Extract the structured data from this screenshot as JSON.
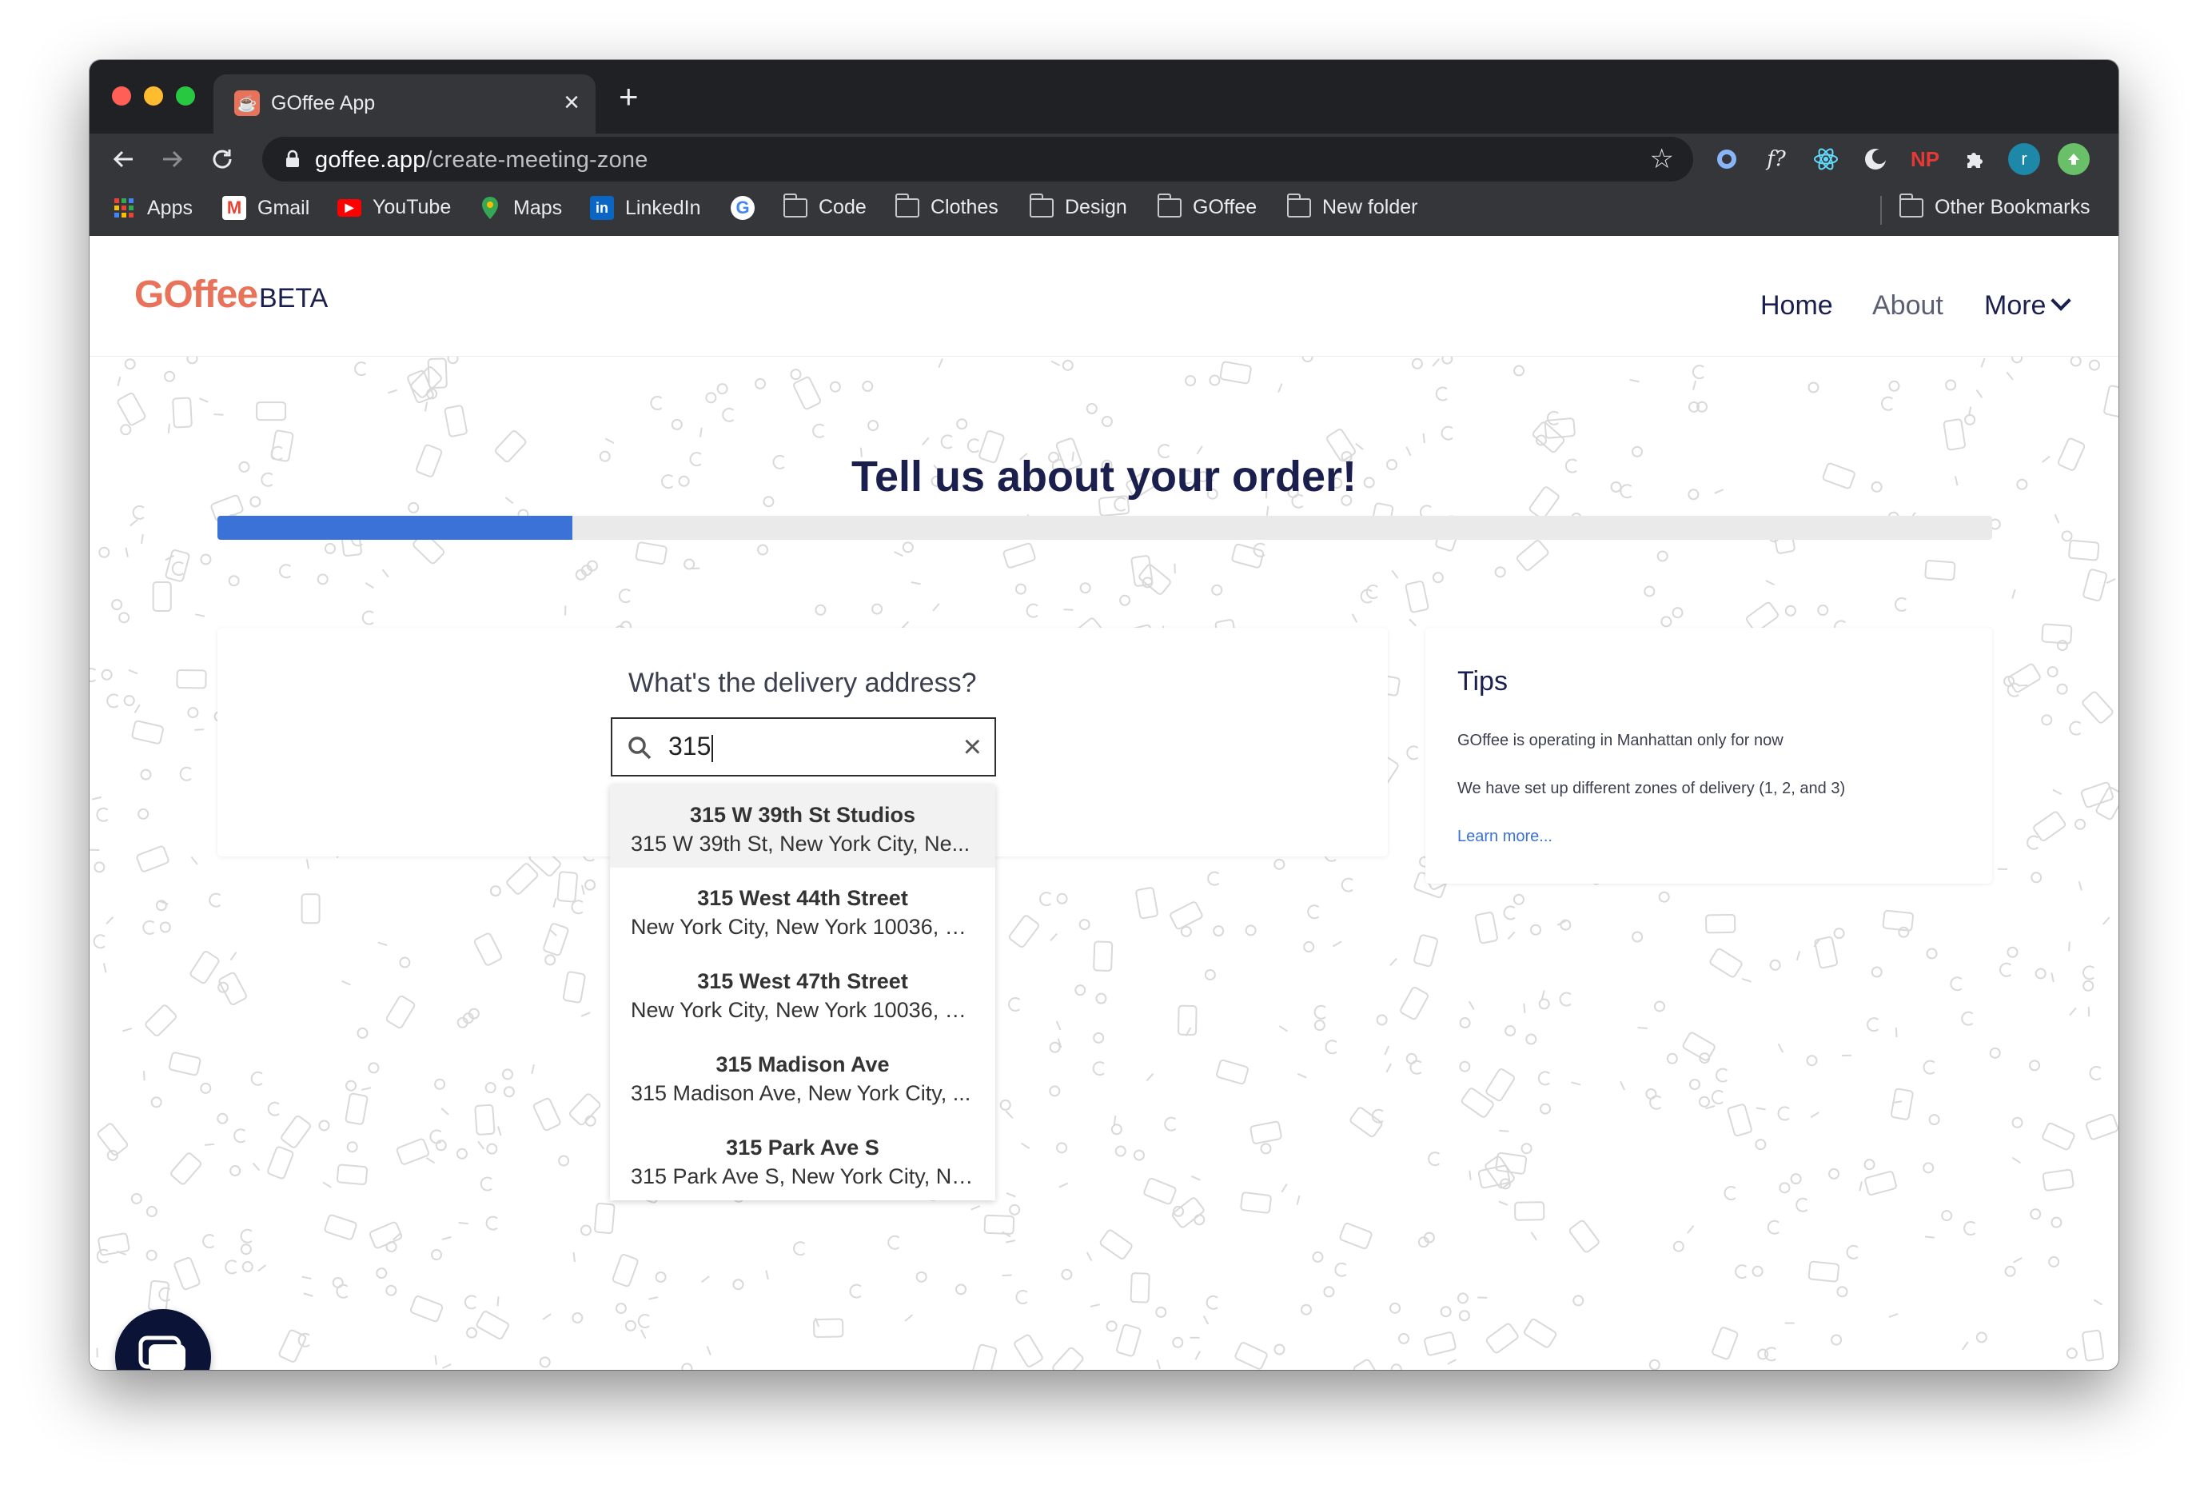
{
  "browser": {
    "tab_title": "GOffee App",
    "tab_close": "×",
    "new_tab": "+",
    "url_host": "goffee.app",
    "url_path": "/create-meeting-zone",
    "bookmarks": [
      "Apps",
      "Gmail",
      "YouTube",
      "Maps",
      "LinkedIn",
      "Code",
      "Clothes",
      "Design",
      "GOffee",
      "New folder"
    ],
    "other_bookmarks": "Other Bookmarks",
    "extensions": [
      "f?",
      "NP",
      "r"
    ]
  },
  "site": {
    "logo_main": "GOffee",
    "logo_beta": "BETA",
    "nav": {
      "home": "Home",
      "about": "About",
      "more": "More"
    }
  },
  "main": {
    "title": "Tell us about your order!",
    "progress_fraction": 0.2,
    "question": "What's the delivery address?",
    "search_value": "315",
    "clear_icon": "×",
    "suggestions": [
      {
        "title": "315 W 39th St Studios",
        "subtitle": "315 W 39th St, New York City, Ne..."
      },
      {
        "title": "315 West 44th Street",
        "subtitle": "New York City, New York 10036, U..."
      },
      {
        "title": "315 West 47th Street",
        "subtitle": "New York City, New York 10036, U..."
      },
      {
        "title": "315 Madison Ave",
        "subtitle": "315 Madison Ave, New York City, ..."
      },
      {
        "title": "315 Park Ave S",
        "subtitle": "315 Park Ave S, New York City, Ne..."
      }
    ]
  },
  "tips": {
    "title": "Tips",
    "items": [
      "GOffee is operating in Manhattan only for now",
      "We have set up different zones of delivery (1, 2, and 3)"
    ],
    "link": "Learn more..."
  },
  "colors": {
    "brand": "#e8735a",
    "navy": "#1a1f4e",
    "progress": "#3a72d8",
    "chrome": "#202124"
  },
  "icons": [
    "back-arrow-icon",
    "forward-arrow-icon",
    "reload-icon",
    "lock-icon",
    "star-icon",
    "search-icon",
    "close-icon",
    "chevron-down-icon",
    "chat-icon",
    "folder-icon"
  ]
}
